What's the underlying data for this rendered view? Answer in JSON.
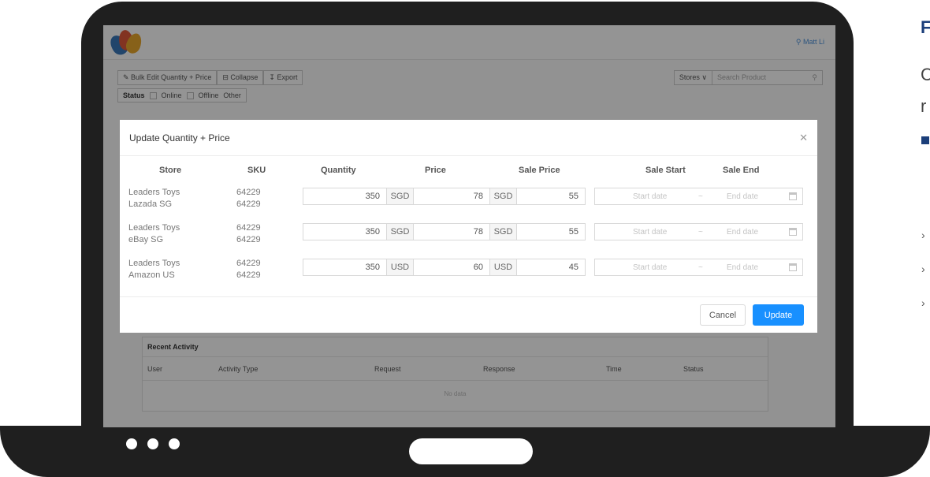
{
  "app": {
    "user_name": "Matt Li",
    "toolbar": {
      "bulk_edit": "Bulk Edit Quantity + Price",
      "collapse": "Collapse",
      "export": "Export"
    },
    "stores_label": "Stores",
    "search_placeholder": "Search Product",
    "status": {
      "label": "Status",
      "online": "Online",
      "offline": "Offline",
      "other": "Other"
    },
    "activity": {
      "title": "Recent Activity",
      "columns": [
        "User",
        "Activity Type",
        "Request",
        "Response",
        "Time",
        "Status"
      ],
      "empty_text": "No data"
    }
  },
  "modal": {
    "title": "Update Quantity + Price",
    "columns": {
      "store": "Store",
      "sku": "SKU",
      "quantity": "Quantity",
      "price": "Price",
      "sale_price": "Sale Price",
      "sale_start": "Sale Start",
      "sale_end": "Sale End"
    },
    "start_placeholder": "Start date",
    "end_placeholder": "End date",
    "range_separator": "~",
    "rows": [
      {
        "store_line1": "Leaders Toys",
        "store_line2": "Lazada SG",
        "sku1": "64229",
        "sku2": "64229",
        "quantity": "350",
        "currency": "SGD",
        "price": "78",
        "sale_currency": "SGD",
        "sale_price": "55"
      },
      {
        "store_line1": "Leaders Toys",
        "store_line2": "eBay SG",
        "sku1": "64229",
        "sku2": "64229",
        "quantity": "350",
        "currency": "SGD",
        "price": "78",
        "sale_currency": "SGD",
        "sale_price": "55"
      },
      {
        "store_line1": "Leaders Toys",
        "store_line2": "Amazon US",
        "sku1": "64229",
        "sku2": "64229",
        "quantity": "350",
        "currency": "USD",
        "price": "60",
        "sale_currency": "USD",
        "sale_price": "45"
      }
    ],
    "cancel_label": "Cancel",
    "update_label": "Update"
  },
  "side": {
    "heading_char": "F",
    "line1_char": "C",
    "line2_char": "r"
  },
  "colors": {
    "primary": "#1890ff",
    "accent_navy": "#1b3f7a",
    "frame": "#1f1f1f"
  }
}
